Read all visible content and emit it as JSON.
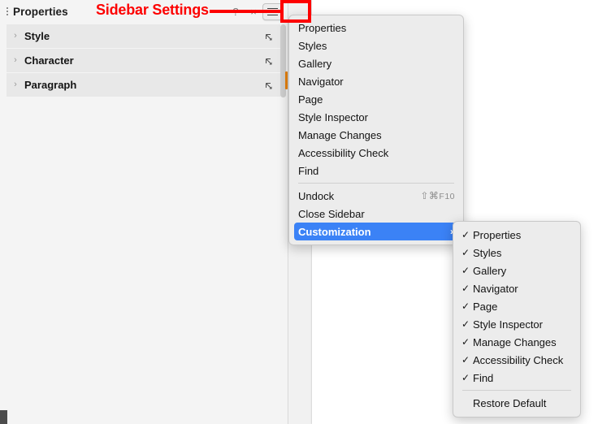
{
  "annotation": {
    "label": "Sidebar Settings",
    "color": "#fd0000",
    "target": "sidebar-settings-hamburger-button"
  },
  "sidebar": {
    "title": "Properties",
    "grip_icon": "vertical-dots-grip-icon",
    "header_buttons": [
      {
        "name": "help-icon",
        "glyph": "?"
      },
      {
        "name": "close-icon",
        "glyph": "×"
      },
      {
        "name": "hamburger-icon",
        "glyph": "≡"
      }
    ],
    "panels": [
      {
        "label": "Style",
        "chevron": "›",
        "launcher_icon": "dialog-launcher-icon"
      },
      {
        "label": "Character",
        "chevron": "›",
        "launcher_icon": "dialog-launcher-icon"
      },
      {
        "label": "Paragraph",
        "chevron": "›",
        "launcher_icon": "dialog-launcher-icon"
      }
    ],
    "splitter_marker_color": "#e8820c"
  },
  "menu": {
    "items": [
      {
        "label": "Properties",
        "shortcut": "",
        "type": "item"
      },
      {
        "label": "Styles",
        "shortcut": "",
        "type": "item"
      },
      {
        "label": "Gallery",
        "shortcut": "",
        "type": "item"
      },
      {
        "label": "Navigator",
        "shortcut": "",
        "type": "item"
      },
      {
        "label": "Page",
        "shortcut": "",
        "type": "item"
      },
      {
        "label": "Style Inspector",
        "shortcut": "",
        "type": "item"
      },
      {
        "label": "Manage Changes",
        "shortcut": "",
        "type": "item"
      },
      {
        "label": "Accessibility Check",
        "shortcut": "",
        "type": "item"
      },
      {
        "label": "Find",
        "shortcut": "",
        "type": "item"
      },
      {
        "type": "separator"
      },
      {
        "label": "Undock",
        "shortcut": "⇧⌘",
        "shortcut_key": "F10",
        "type": "item"
      },
      {
        "label": "Close Sidebar",
        "shortcut": "",
        "type": "item"
      },
      {
        "label": "Customization",
        "shortcut": "",
        "type": "submenu",
        "selected": true,
        "arrow": "›"
      }
    ],
    "highlight_color": "#3b82f6"
  },
  "submenu": {
    "items": [
      {
        "label": "Properties",
        "checked": true,
        "check": "✓"
      },
      {
        "label": "Styles",
        "checked": true,
        "check": "✓"
      },
      {
        "label": "Gallery",
        "checked": true,
        "check": "✓"
      },
      {
        "label": "Navigator",
        "checked": true,
        "check": "✓"
      },
      {
        "label": "Page",
        "checked": true,
        "check": "✓"
      },
      {
        "label": "Style Inspector",
        "checked": true,
        "check": "✓"
      },
      {
        "label": "Manage Changes",
        "checked": true,
        "check": "✓"
      },
      {
        "label": "Accessibility Check",
        "checked": true,
        "check": "✓"
      },
      {
        "label": "Find",
        "checked": true,
        "check": "✓"
      },
      {
        "type": "separator"
      },
      {
        "label": "Restore Default",
        "checked": false,
        "check": ""
      }
    ]
  }
}
